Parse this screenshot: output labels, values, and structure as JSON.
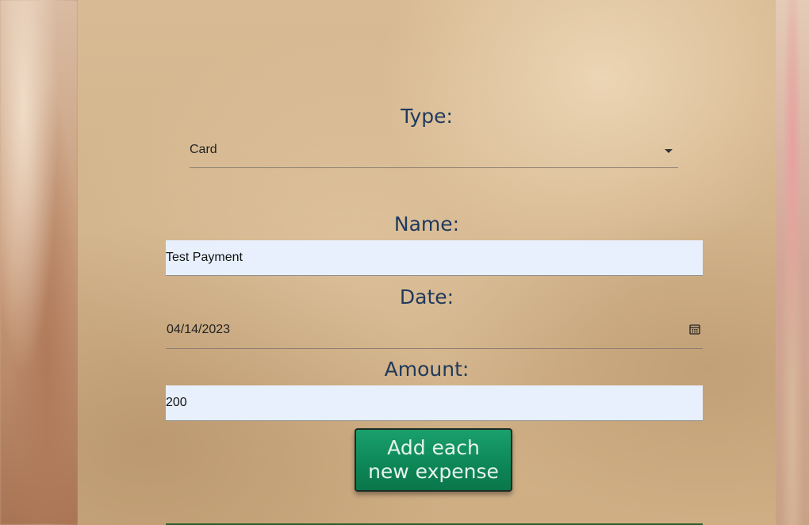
{
  "form": {
    "type_label": "Type:",
    "type_value": "Card",
    "name_label": "Name:",
    "name_value": "Test Payment",
    "date_label": "Date:",
    "date_value": "04/14/2023",
    "amount_label": "Amount:",
    "amount_value": "200",
    "submit_label": "Add each new expense"
  },
  "icons": {
    "type_caret": "chevron-down-icon",
    "date_picker": "calendar-icon"
  },
  "colors": {
    "label": "#1f3a5c",
    "button": "#0d8656",
    "input_bg": "#e8f0fe"
  }
}
